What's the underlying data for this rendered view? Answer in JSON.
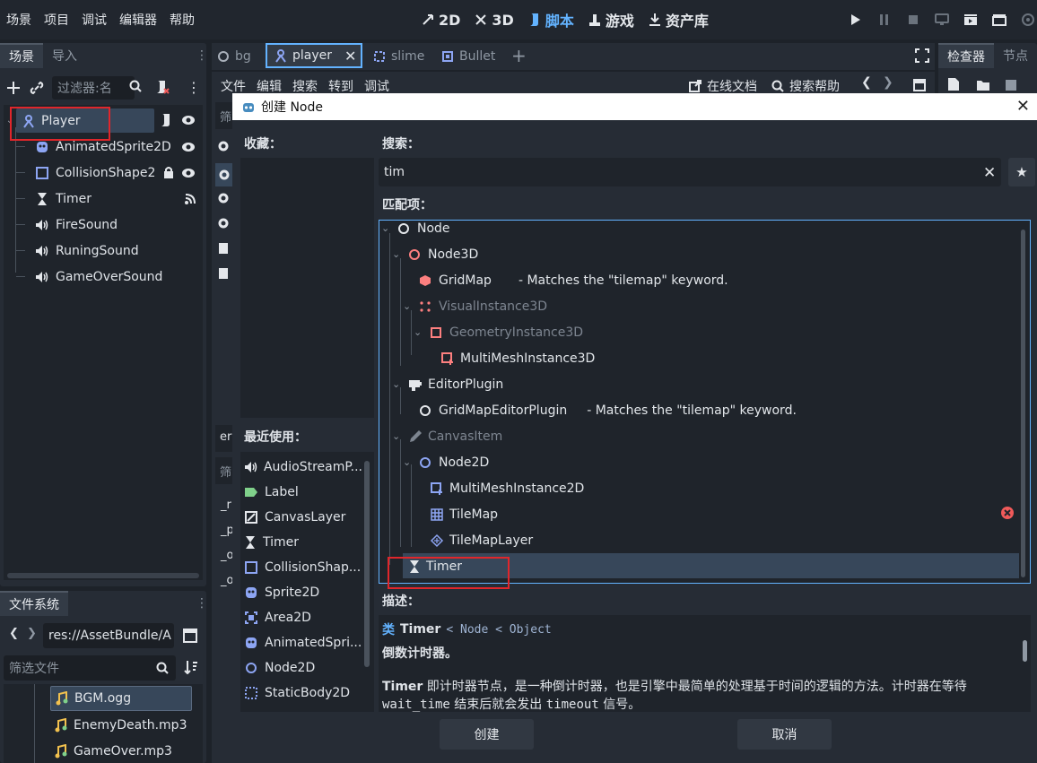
{
  "menu": [
    "场景",
    "项目",
    "调试",
    "编辑器",
    "帮助"
  ],
  "workspaces": [
    {
      "label": "2D",
      "icon": "2d-icon"
    },
    {
      "label": "3D",
      "icon": "3d-icon"
    },
    {
      "label": "脚本",
      "icon": "script-icon"
    },
    {
      "label": "游戏",
      "icon": "game-icon"
    },
    {
      "label": "资产库",
      "icon": "asset-library-icon"
    }
  ],
  "scene_panel": {
    "tabs": [
      "场景",
      "导入"
    ],
    "filter_placeholder": "过滤器:名",
    "nodes": [
      {
        "label": "Player",
        "icon": "character-icon"
      },
      {
        "label": "AnimatedSprite2D",
        "icon": "animated-sprite-icon"
      },
      {
        "label": "CollisionShape2",
        "icon": "collision-shape-icon"
      },
      {
        "label": "Timer",
        "icon": "timer-icon"
      },
      {
        "label": "FireSound",
        "icon": "audio-icon"
      },
      {
        "label": "RuningSound",
        "icon": "audio-icon"
      },
      {
        "label": "GameOverSound",
        "icon": "audio-icon"
      }
    ]
  },
  "filesystem": {
    "tab": "文件系统",
    "path": "res://AssetBundle/A",
    "filter_placeholder": "筛选文件",
    "files": [
      "BGM.ogg",
      "EnemyDeath.mp3",
      "GameOver.mp3"
    ]
  },
  "editor_tabs": [
    "bg",
    "player",
    "slime",
    "Bullet"
  ],
  "script_menu": [
    "文件",
    "编辑",
    "搜索",
    "转到",
    "调试"
  ],
  "script_toolbar": {
    "online_docs": "在线文档",
    "search_help": "搜索帮助"
  },
  "left_editor_fragments": {
    "filter1": "筛",
    "filter2": "筛",
    "text_er": "er",
    "lines": [
      "_r",
      "_p",
      "_o",
      "_o"
    ]
  },
  "right_tabs": [
    "检查器",
    "节点"
  ],
  "dialog": {
    "title": "创建 Node",
    "favorites_label": "收藏：",
    "recent_label": "最近使用：",
    "search_label": "搜索：",
    "search_value": "tim",
    "matches_label": "匹配项：",
    "description_label": "描述：",
    "recent": [
      {
        "label": "AudioStreamP...",
        "icon": "audio-icon"
      },
      {
        "label": "Label",
        "icon": "label-icon"
      },
      {
        "label": "CanvasLayer",
        "icon": "canvas-layer-icon"
      },
      {
        "label": "Timer",
        "icon": "timer-icon"
      },
      {
        "label": "CollisionShap...",
        "icon": "collision-shape-icon"
      },
      {
        "label": "Sprite2D",
        "icon": "sprite-icon"
      },
      {
        "label": "Area2D",
        "icon": "area2d-icon"
      },
      {
        "label": "AnimatedSpri...",
        "icon": "animated-sprite-icon"
      },
      {
        "label": "Node2D",
        "icon": "node2d-icon"
      },
      {
        "label": "StaticBody2D",
        "icon": "static-body-icon"
      }
    ],
    "matches": [
      {
        "label": "Node",
        "note": ""
      },
      {
        "label": "Node3D",
        "note": ""
      },
      {
        "label": "GridMap",
        "note": "- Matches the \"tilemap\" keyword."
      },
      {
        "label": "VisualInstance3D",
        "note": ""
      },
      {
        "label": "GeometryInstance3D",
        "note": ""
      },
      {
        "label": "MultiMeshInstance3D",
        "note": ""
      },
      {
        "label": "EditorPlugin",
        "note": ""
      },
      {
        "label": "GridMapEditorPlugin",
        "note": "- Matches the \"tilemap\" keyword."
      },
      {
        "label": "CanvasItem",
        "note": ""
      },
      {
        "label": "Node2D",
        "note": ""
      },
      {
        "label": "MultiMeshInstance2D",
        "note": ""
      },
      {
        "label": "TileMap",
        "note": ""
      },
      {
        "label": "TileMapLayer",
        "note": ""
      },
      {
        "label": "Timer",
        "note": ""
      }
    ],
    "desc": {
      "class_prefix": "类",
      "class_name": "Timer",
      "inherits": "< Node < Object",
      "summary": "倒数计时器。",
      "body_bold": "Timer",
      "body_1": " 即计时器节点，是一种倒计时器，也是引擎中最简单的处理基于时间的逻辑的方法。计时器在等待",
      "code_1": "wait_time",
      "body_2": " 结束后就会发出 ",
      "code_2": "timeout",
      "body_3": " 信号。"
    },
    "create_button": "创建",
    "cancel_button": "取消"
  },
  "colors": {
    "accent": "#63b3ff",
    "highlight": "#e0262b",
    "selected": "#37475a"
  }
}
